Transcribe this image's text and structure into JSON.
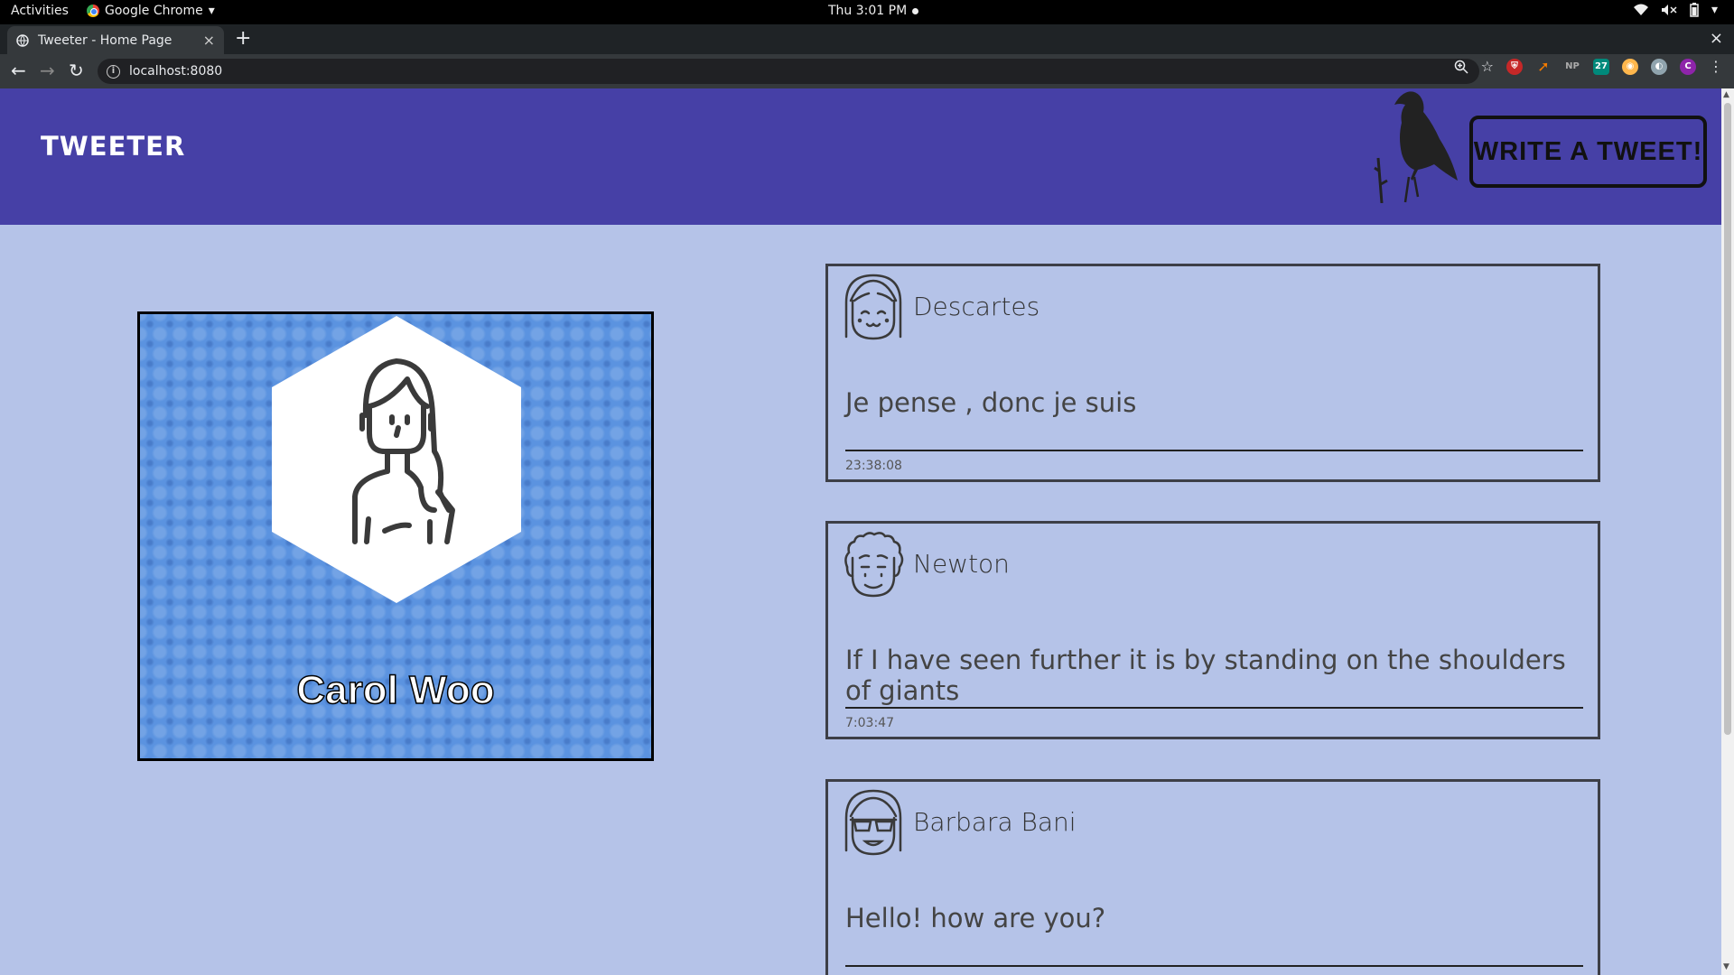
{
  "os_bar": {
    "activities": "Activities",
    "app_name": "Google Chrome",
    "clock": "Thu  3:01 PM"
  },
  "browser": {
    "tab_title": "Tweeter - Home Page",
    "tab_close": "×",
    "new_tab": "+",
    "window_close": "×",
    "url": "localhost:8080",
    "extensions": [
      "shield-ext",
      "arrow-ext",
      "NP",
      "27",
      "owl-ext",
      "globe-ext",
      "C"
    ]
  },
  "header": {
    "brand": "TWEETER",
    "write_button": "WRITE A TWEET!",
    "colors": {
      "background": "#4640a6"
    }
  },
  "profile": {
    "name": "Carol Woo",
    "avatar_icon": "woman-avatar-icon"
  },
  "tweets": [
    {
      "author": "Descartes",
      "text": "Je pense , donc je suis",
      "time": "23:38:08",
      "avatar_icon": "descartes-avatar-icon"
    },
    {
      "author": "Newton",
      "text": "If I have seen further it is by standing on the shoulders of giants",
      "time": "7:03:47",
      "avatar_icon": "newton-avatar-icon"
    },
    {
      "author": "Barbara Bani",
      "text": "Hello! how are you?",
      "time": "",
      "avatar_icon": "barbara-avatar-icon"
    }
  ],
  "colors": {
    "page_bg": "#b5c3e8",
    "card_bg": "#5b93e0"
  }
}
